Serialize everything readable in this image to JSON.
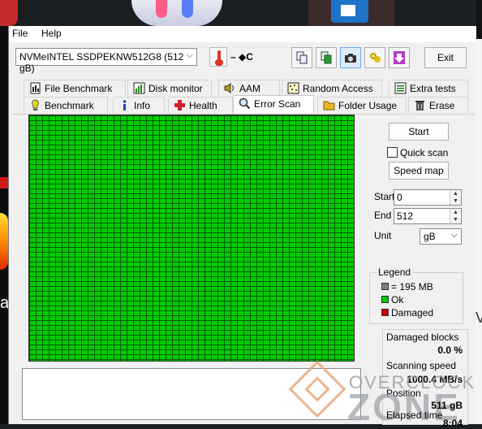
{
  "menu": {
    "file": "File",
    "help": "Help"
  },
  "toolbar": {
    "drive": "NVMeINTEL SSDPEKNW512G8 (512 gB)",
    "temperature": "– ◆C",
    "exit_label": "Exit"
  },
  "tabs_top": [
    {
      "label": "File Benchmark",
      "icon": "file-benchmark-icon"
    },
    {
      "label": "Disk monitor",
      "icon": "disk-monitor-icon"
    },
    {
      "label": "AAM",
      "icon": "speaker-icon"
    },
    {
      "label": "Random Access",
      "icon": "random-access-icon"
    },
    {
      "label": "Extra tests",
      "icon": "extra-tests-icon"
    }
  ],
  "tabs_bottom": [
    {
      "label": "Benchmark",
      "icon": "benchmark-icon"
    },
    {
      "label": "Info",
      "icon": "info-icon"
    },
    {
      "label": "Health",
      "icon": "health-icon"
    },
    {
      "label": "Error Scan",
      "icon": "magnifier-icon",
      "active": true
    },
    {
      "label": "Folder Usage",
      "icon": "folder-icon"
    },
    {
      "label": "Erase",
      "icon": "trash-icon"
    }
  ],
  "scan": {
    "start_button": "Start",
    "quick_scan": "Quick scan",
    "quick_scan_checked": false,
    "speed_map_button": "Speed map",
    "start_label": "Start",
    "start_value": "0",
    "end_label": "End",
    "end_value": "512",
    "unit_label": "Unit",
    "unit_value": "gB"
  },
  "legend": {
    "title": "Legend",
    "block": "= 195 MB",
    "ok": "Ok",
    "damaged": "Damaged",
    "block_color": "#808080",
    "ok_color": "#00cc00",
    "damaged_color": "#cc0000"
  },
  "stats": {
    "damaged_blocks_label": "Damaged blocks",
    "damaged_blocks_value": "0.0 %",
    "scanning_speed_label": "Scanning speed",
    "scanning_speed_value": "1000.4 MB/s",
    "position_label": "Position",
    "position_value": "511 gB",
    "elapsed_label": "Elapsed time",
    "elapsed_value": "8:04"
  },
  "watermark": {
    "top": "OVERCLOCK",
    "bottom": "ZONE"
  },
  "colors": {
    "grid_ok": "#00cc00",
    "grid_line": "#0a5a0a"
  }
}
